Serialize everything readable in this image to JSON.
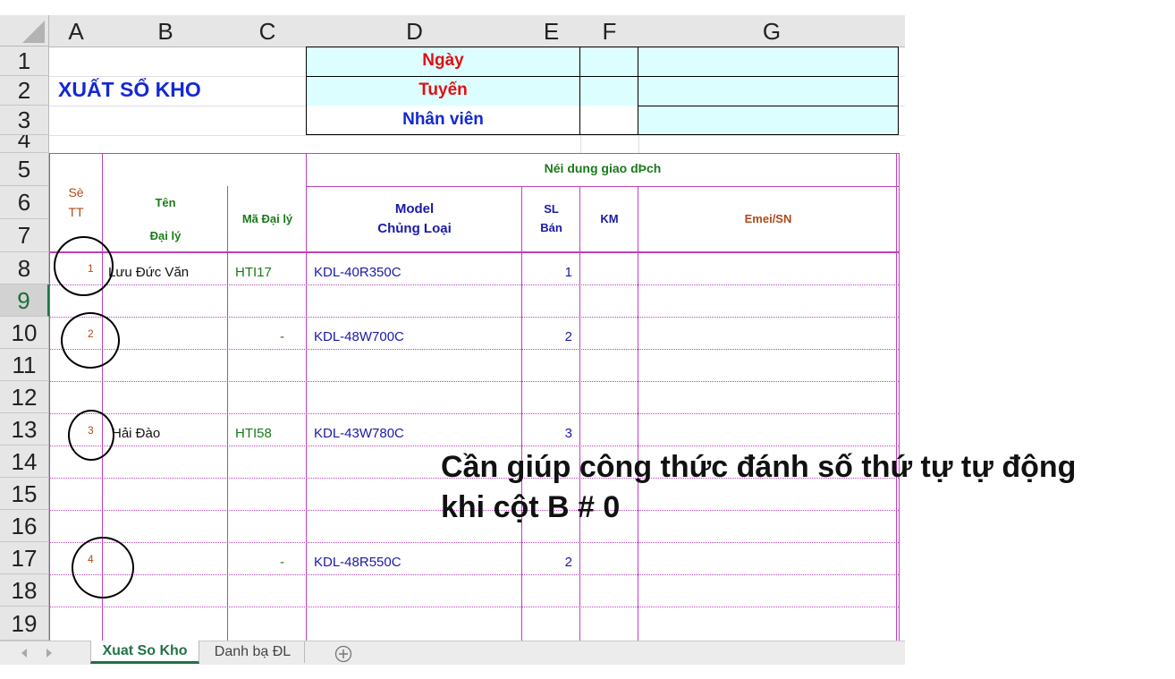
{
  "columns": [
    "A",
    "B",
    "C",
    "D",
    "E",
    "F",
    "G"
  ],
  "rows": [
    "1",
    "2",
    "3",
    "4",
    "5",
    "6",
    "7",
    "8",
    "9",
    "10",
    "11",
    "12",
    "13",
    "14",
    "15",
    "16",
    "17",
    "18",
    "19"
  ],
  "title": "XUẤT SỔ KHO",
  "info_labels": [
    "Ngày",
    "Tuyến",
    "Nhân viên"
  ],
  "headers": {
    "so_tt": [
      "Sè",
      "TT"
    ],
    "ten": [
      "Tên",
      "Đại lý"
    ],
    "ma_dai_ly": "Mã Đại lý",
    "noi_dung": "Néi dung giao dÞch",
    "model": [
      "Model",
      "Chủng Loại"
    ],
    "sl": [
      "SL",
      "Bán"
    ],
    "km": "KM",
    "emei": "Emei/SN"
  },
  "data_rows": [
    {
      "stt": "1",
      "ten": "Lưu Đức Văn",
      "ma": "HTI17",
      "model": "KDL-40R350C",
      "sl": "1"
    },
    {
      "stt": "2",
      "ten": "",
      "ma": "-",
      "model": "KDL-48W700C",
      "sl": "2"
    },
    {
      "stt": "3",
      "ten": "Hải Đào",
      "ma": "HTI58",
      "model": "KDL-43W780C",
      "sl": "3"
    },
    {
      "stt": "4",
      "ten": "",
      "ma": "-",
      "model": "KDL-48R550C",
      "sl": "2"
    }
  ],
  "annotation": [
    "Cần giúp công thức đánh số thứ tự tự động",
    "khi cột B # 0"
  ],
  "sheet_tabs": [
    "Xuat So Kho",
    "Danh bạ ĐL"
  ],
  "add_sheet_icon": "plus-circle-icon",
  "colors": {
    "title": "#1428d2",
    "red": "#e01010",
    "info_bg": "#ddfefe",
    "green": "#1a7a1a",
    "blue": "#1a1aa8",
    "magenta": "#c040c0"
  }
}
